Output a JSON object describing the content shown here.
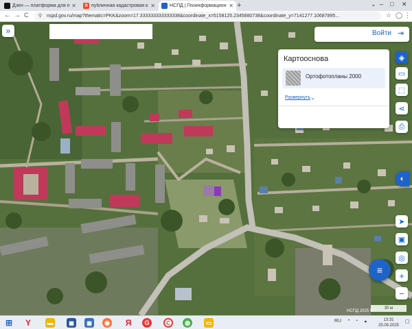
{
  "browser": {
    "tabs": [
      {
        "title": "Дзен — платформа для просм",
        "favicon_color": "#111111",
        "favicon_glyph": "",
        "active": false
      },
      {
        "title": "публичная кадастровая карта",
        "favicon_color": "#f04a24",
        "favicon_glyph": "Я",
        "active": false
      },
      {
        "title": "НСПД | Геоинформационный",
        "favicon_color": "#1e63c8",
        "favicon_glyph": "",
        "active": true
      }
    ],
    "new_tab_glyph": "+",
    "window_controls": {
      "minimize": "–",
      "maximize": "□",
      "close": "✕",
      "dropdown": "⌄"
    },
    "nav": {
      "back": "←",
      "forward": "→",
      "reload": "C"
    },
    "address": "nspd.gov.ru/map?thematic=PKK&zoom=17.333333333333338&coordinate_x=5158125.2345880738&coordinate_y=7141277.10687895..."
  },
  "map": {
    "collapse_button": "»",
    "login": {
      "label": "Войти",
      "icon": "login-arrow-icon"
    },
    "basemap_panel": {
      "title": "Картооснова",
      "selected_layer": "Ортофотопланы 2000",
      "expand_label": "Развернуть"
    },
    "right_tools": [
      {
        "name": "layers-button",
        "glyph": "◈",
        "active": true
      },
      {
        "name": "ruler-button",
        "glyph": "▭"
      },
      {
        "name": "select-area-button",
        "glyph": "⬚"
      },
      {
        "name": "share-button",
        "glyph": "⋖"
      },
      {
        "name": "print-button",
        "glyph": "⎙"
      },
      {
        "name": "legend-button",
        "glyph": "◐"
      },
      {
        "name": "navigate-button",
        "glyph": "➤"
      },
      {
        "name": "screen-button",
        "glyph": "▣"
      },
      {
        "name": "locate-button",
        "glyph": "◎"
      }
    ],
    "zoom_in": "+",
    "zoom_out": "−",
    "menu_fab_glyph": "≡",
    "scale_label": "30 м",
    "copyright": "НСПД 2025 ©"
  },
  "taskbar": {
    "icons": [
      {
        "name": "start-icon",
        "glyph": "⊞",
        "color": "#1e63c8"
      },
      {
        "name": "yandex-icon",
        "glyph": "Y",
        "color": "#e8212a"
      },
      {
        "name": "explorer-icon",
        "glyph": "▬",
        "color": "#f2b705"
      },
      {
        "name": "app-icon",
        "glyph": "▦",
        "color": "#2b579a"
      },
      {
        "name": "firefox-icon",
        "glyph": "◉",
        "color": "#ff7139"
      },
      {
        "name": "yandex-browser-icon",
        "glyph": "Я",
        "color": "#e8212a"
      },
      {
        "name": "app2-icon",
        "glyph": "G",
        "color": "#e53935"
      },
      {
        "name": "chrome-icon",
        "glyph": "◍",
        "color": "#4caf50"
      },
      {
        "name": "folder-icon",
        "glyph": "▭",
        "color": "#f2b705"
      }
    ],
    "lang": "RU",
    "time": "13:31",
    "date": "25.09.2025"
  },
  "colors": {
    "accent": "#1e63c8",
    "roof_red": "#c0395a"
  }
}
